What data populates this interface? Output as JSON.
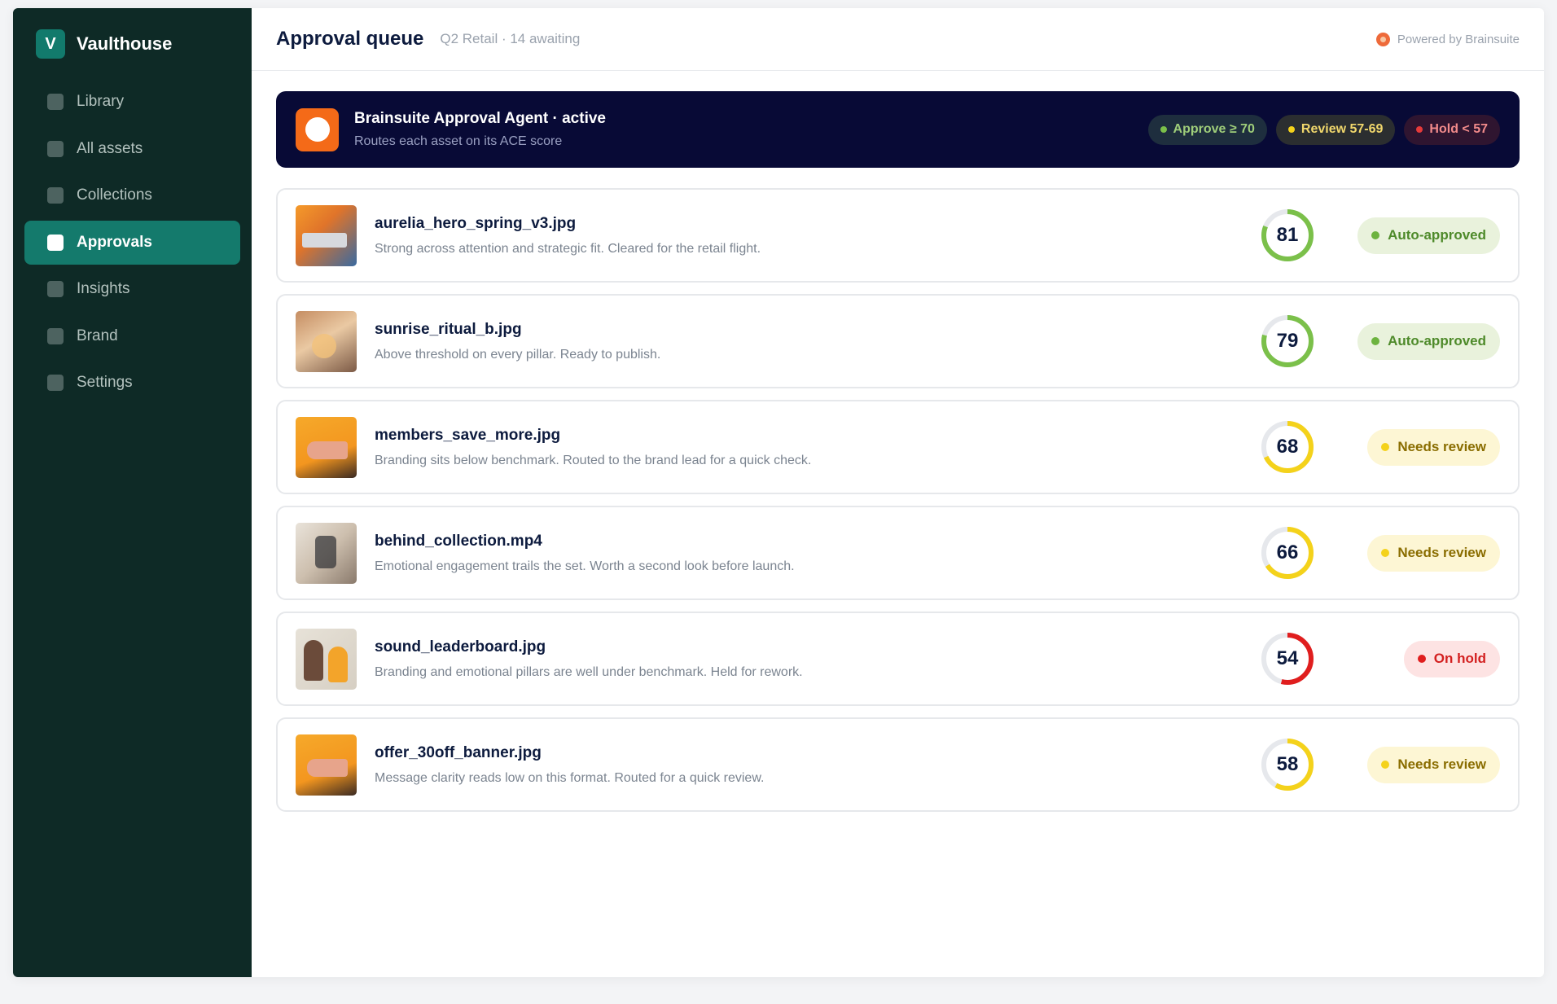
{
  "brand": {
    "logo_letter": "V",
    "name": "Vaulthouse"
  },
  "sidebar": {
    "items": [
      {
        "label": "Library",
        "key": "library",
        "active": false
      },
      {
        "label": "All assets",
        "key": "all-assets",
        "active": false
      },
      {
        "label": "Collections",
        "key": "collections",
        "active": false
      },
      {
        "label": "Approvals",
        "key": "approvals",
        "active": true
      },
      {
        "label": "Insights",
        "key": "insights",
        "active": false
      },
      {
        "label": "Brand",
        "key": "brand",
        "active": false
      },
      {
        "label": "Settings",
        "key": "settings",
        "active": false
      }
    ]
  },
  "header": {
    "title": "Approval queue",
    "subtitle": "Q2 Retail · 14 awaiting",
    "powered_by": "Powered by Brainsuite"
  },
  "agent": {
    "title": "Brainsuite Approval Agent · active",
    "description": "Routes each asset on its ACE score",
    "thresholds": [
      {
        "label": "Approve ≥ 70",
        "kind": "approve"
      },
      {
        "label": "Review 57-69",
        "kind": "review"
      },
      {
        "label": "Hold < 57",
        "kind": "hold"
      }
    ]
  },
  "colors": {
    "sidebar_bg": "#0e2a26",
    "accent": "#147a6c",
    "banner_bg": "#080a36",
    "agent_orange": "#f46a18",
    "score_green": "#7bc04a",
    "score_yellow": "#f4d21b",
    "score_red": "#e01e1e"
  },
  "assets": [
    {
      "name": "aurelia_hero_spring_v3.jpg",
      "note": "Strong across attention and strategic fit. Cleared for the retail flight.",
      "score": 81,
      "status": "Auto-approved",
      "kind": "approved"
    },
    {
      "name": "sunrise_ritual_b.jpg",
      "note": "Above threshold on every pillar. Ready to publish.",
      "score": 79,
      "status": "Auto-approved",
      "kind": "approved"
    },
    {
      "name": "members_save_more.jpg",
      "note": "Branding sits below benchmark. Routed to the brand lead for a quick check.",
      "score": 68,
      "status": "Needs review",
      "kind": "review"
    },
    {
      "name": "behind_collection.mp4",
      "note": "Emotional engagement trails the set. Worth a second look before launch.",
      "score": 66,
      "status": "Needs review",
      "kind": "review"
    },
    {
      "name": "sound_leaderboard.jpg",
      "note": "Branding and emotional pillars are well under benchmark. Held for rework.",
      "score": 54,
      "status": "On hold",
      "kind": "hold"
    },
    {
      "name": "offer_30off_banner.jpg",
      "note": "Message clarity reads low on this format. Routed for a quick review.",
      "score": 58,
      "status": "Needs review",
      "kind": "review"
    }
  ]
}
